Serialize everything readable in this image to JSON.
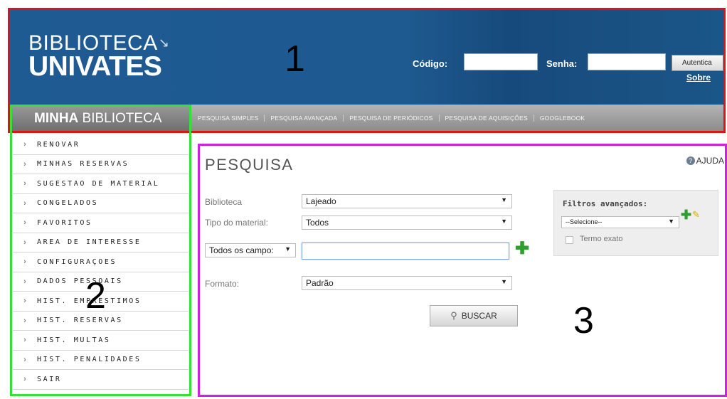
{
  "header": {
    "logo_top": "BIBLIOTECA",
    "logo_mark": "↘",
    "logo_bottom": "UNIVATES",
    "codigo_label": "Código:",
    "senha_label": "Senha:",
    "auth_button": "Autentica",
    "sobre_link": "Sobre"
  },
  "navbar": {
    "brand_bold": "MINHA",
    "brand_rest": " BIBLIOTECA",
    "tabs": [
      "PESQUISA SIMPLES",
      "PESQUISA AVANÇADA",
      "PESQUISA DE PERIÓDICOS",
      "PESQUISA DE AQUISIÇÕES",
      "GOOGLEBOOK"
    ]
  },
  "sidebar": {
    "items": [
      "RENOVAR",
      "MINHAS RESERVAS",
      "SUGESTÃO DE MATERIAL",
      "CONGELADOS",
      "FAVORITOS",
      "ÁREA DE INTERESSE",
      "CONFIGURAÇÕES",
      "DADOS PESSOAIS",
      "HIST. EMPRÉSTIMOS",
      "HIST. RESERVAS",
      "HIST. MULTAS",
      "HIST. PENALIDADES",
      "SAIR"
    ]
  },
  "main": {
    "title": "PESQUISA",
    "help": "AJUDA",
    "biblioteca_label": "Biblioteca",
    "biblioteca_value": "Lajeado",
    "tipo_label": "Tipo do material:",
    "tipo_value": "Todos",
    "campo_value": "Todos os campo:",
    "search_value": "",
    "formato_label": "Formato:",
    "formato_value": "Padrão",
    "buscar_button": "BUSCAR"
  },
  "filters": {
    "title": "Filtros avançados:",
    "select_value": "--Selecione--",
    "checkbox_label": "Termo exato",
    "checkbox_checked": false
  },
  "annotations": {
    "one": "1",
    "two": "2",
    "three": "3",
    "colors": {
      "header_box": "#e01414",
      "sidebar_box": "#36e036",
      "main_box": "#d020e0"
    }
  }
}
